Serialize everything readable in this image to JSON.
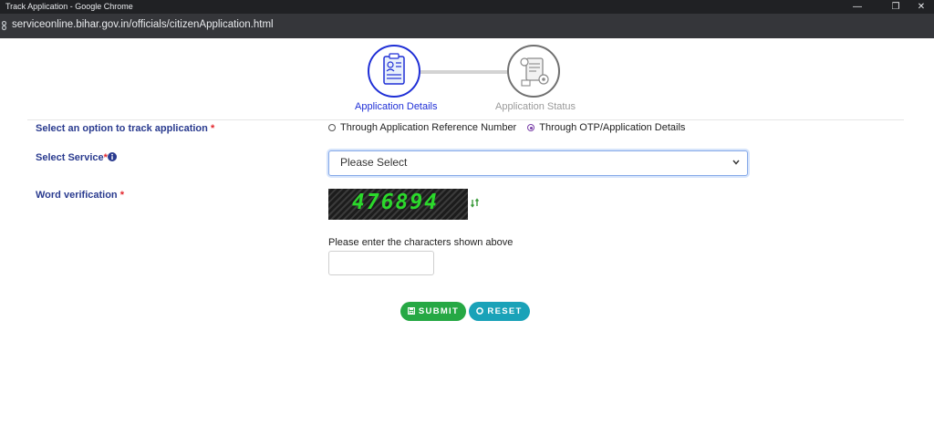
{
  "window": {
    "title": "Track Application - Google Chrome",
    "controls": {
      "minimize": "—",
      "restore": "❐",
      "close": "✕"
    }
  },
  "browser": {
    "url": "serviceonline.bihar.gov.in/officials/citizenApplication.html",
    "site_icon": "site-info-icon"
  },
  "steps": [
    {
      "label": "Application Details",
      "icon": "application-form-icon",
      "active": true
    },
    {
      "label": "Application Status",
      "icon": "status-settings-icon",
      "active": false
    }
  ],
  "form": {
    "track_option": {
      "label": "Select an option to track application",
      "required": "*",
      "options": [
        {
          "label": "Through Application Reference Number",
          "selected": false
        },
        {
          "label": "Through OTP/Application Details",
          "selected": true
        }
      ]
    },
    "service": {
      "label": "Select Service",
      "required": "*",
      "info_icon": "info-icon",
      "value": "Please Select"
    },
    "word_verification": {
      "label": "Word verification",
      "required": "*",
      "captcha_text": "476894",
      "refresh_icon": "refresh-icon",
      "hint": "Please enter the characters shown above",
      "value": ""
    }
  },
  "buttons": {
    "submit": {
      "label": "SUBMIT",
      "icon": "save-icon"
    },
    "reset": {
      "label": "RESET",
      "icon": "reset-circle-icon"
    }
  },
  "colors": {
    "label_blue": "#2a3b8f",
    "active_step": "#1f2fd6",
    "submit_green": "#26a844",
    "reset_teal": "#1aa2b8",
    "required_red": "#e3262c",
    "captcha_green": "#2bd92b"
  }
}
